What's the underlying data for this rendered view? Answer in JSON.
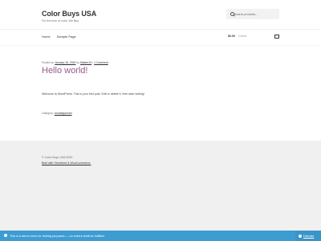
{
  "site": {
    "title": "Color Buys USA",
    "tagline": "For the love of color, We Buy."
  },
  "search": {
    "placeholder": "Search products…"
  },
  "nav": {
    "items": [
      "Home",
      "Sample Page"
    ]
  },
  "cart": {
    "amount": "$0.00",
    "count": "0 items"
  },
  "post": {
    "meta_prefix": "Posted on",
    "date": "January 16, 2020",
    "by": "by",
    "author": "Master10",
    "comments": "1 Comment",
    "title": "Hello world!",
    "body": "Welcome to WordPress. This is your first post. Edit or delete it, then start writing!",
    "category_label": "Category:",
    "category": "Uncategorized"
  },
  "footer": {
    "copyright": "© Color Buys USA 2020",
    "built": "Built with Storefront & WooCommerce."
  },
  "notice": {
    "message": "This is a demo store for testing purposes — no orders shall be fulfilled.",
    "dismiss": "Dismiss"
  },
  "colors": {
    "accent": "#96588a",
    "notice_bg": "#3d9cd2",
    "footer_bg": "#f0f0f0"
  }
}
